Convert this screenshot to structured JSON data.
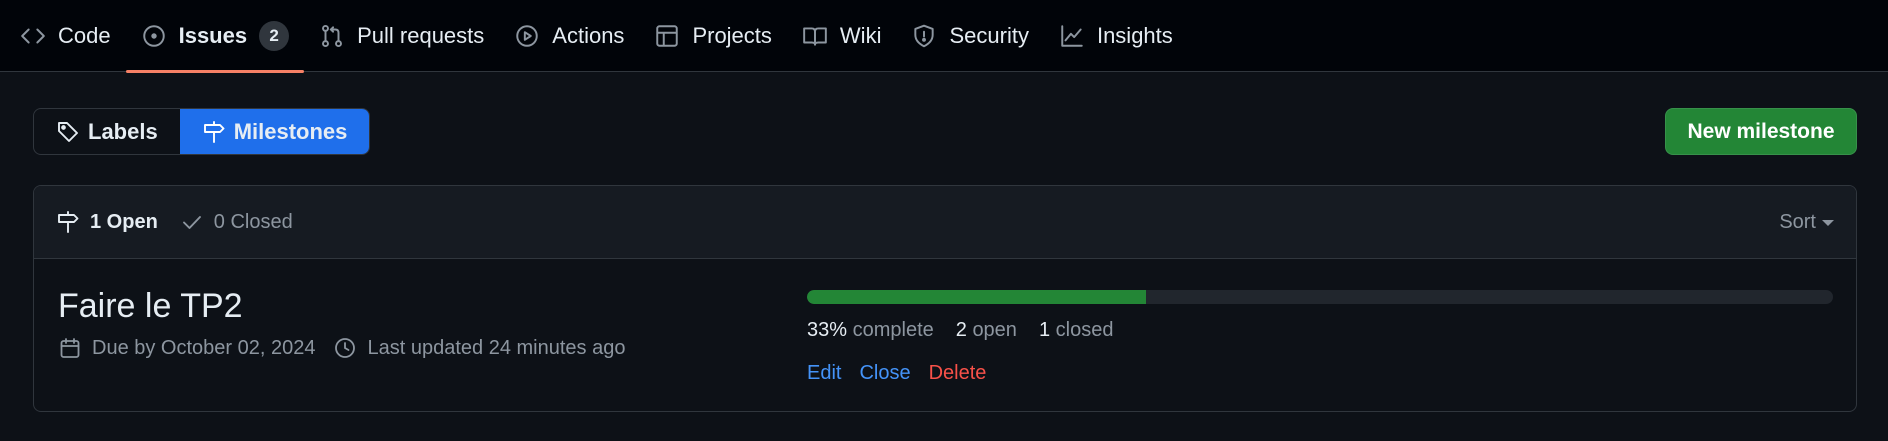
{
  "nav": {
    "items": [
      {
        "label": "Code",
        "icon": "code-icon"
      },
      {
        "label": "Issues",
        "icon": "issue-opened-icon",
        "count": "2",
        "active": true
      },
      {
        "label": "Pull requests",
        "icon": "git-pull-request-icon"
      },
      {
        "label": "Actions",
        "icon": "play-icon"
      },
      {
        "label": "Projects",
        "icon": "table-icon"
      },
      {
        "label": "Wiki",
        "icon": "book-icon"
      },
      {
        "label": "Security",
        "icon": "shield-icon"
      },
      {
        "label": "Insights",
        "icon": "graph-icon"
      }
    ]
  },
  "subnav": {
    "labels": "Labels",
    "milestones": "Milestones"
  },
  "new_milestone_label": "New milestone",
  "list": {
    "open_count": "1 Open",
    "closed_count": "0 Closed",
    "sort_label": "Sort"
  },
  "milestone": {
    "title": "Faire le TP2",
    "due": "Due by October 02, 2024",
    "updated": "Last updated 24 minutes ago",
    "progress_percent": 33,
    "complete_num": "33%",
    "complete_label": "complete",
    "open_num": "2",
    "open_label": "open",
    "closed_num": "1",
    "closed_label": "closed",
    "edit": "Edit",
    "close": "Close",
    "delete": "Delete"
  },
  "colors": {
    "accent_underline": "#f78166",
    "selected_tab": "#1f6feb",
    "primary_button": "#238636",
    "progress": "#238636",
    "link": "#4493f8",
    "danger": "#f85149"
  }
}
